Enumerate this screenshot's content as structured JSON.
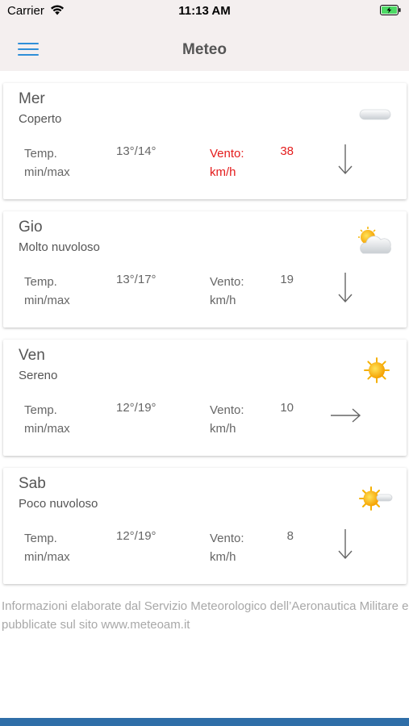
{
  "status_bar": {
    "carrier": "Carrier",
    "time": "11:13 AM"
  },
  "header": {
    "title": "Meteo",
    "menu_icon": "hamburger-menu-icon",
    "accent": "#2f8fd8"
  },
  "forecast": [
    {
      "day": "Mer",
      "condition": "Coperto",
      "icon": "overcast-icon",
      "temp_label": "Temp. min/max",
      "temp": "13°/14°",
      "wind_label": "Vento: km/h",
      "wind_speed": "38",
      "wind_strong": true,
      "wind_direction": "south"
    },
    {
      "day": "Gio",
      "condition": "Molto nuvoloso",
      "icon": "mostly-cloudy-icon",
      "temp_label": "Temp. min/max",
      "temp": "13°/17°",
      "wind_label": "Vento: km/h",
      "wind_speed": "19",
      "wind_strong": false,
      "wind_direction": "south"
    },
    {
      "day": "Ven",
      "condition": "Sereno",
      "icon": "sun-icon",
      "temp_label": "Temp. min/max",
      "temp": "12°/19°",
      "wind_label": "Vento: km/h",
      "wind_speed": "10",
      "wind_strong": false,
      "wind_direction": "east"
    },
    {
      "day": "Sab",
      "condition": "Poco nuvoloso",
      "icon": "partly-cloudy-icon",
      "temp_label": "Temp. min/max",
      "temp": "12°/19°",
      "wind_label": "Vento: km/h",
      "wind_speed": "8",
      "wind_strong": false,
      "wind_direction": "south"
    }
  ],
  "footer": {
    "note": "Informazioni elaborate dal Servizio Meteorologico dell’Aeronautica Militare e pubblicate sul sito www.meteoam.it"
  },
  "colors": {
    "strong_wind": "#e41c1c",
    "bottom_bar": "#2f6ea8",
    "header_bg": "#f4efef"
  }
}
